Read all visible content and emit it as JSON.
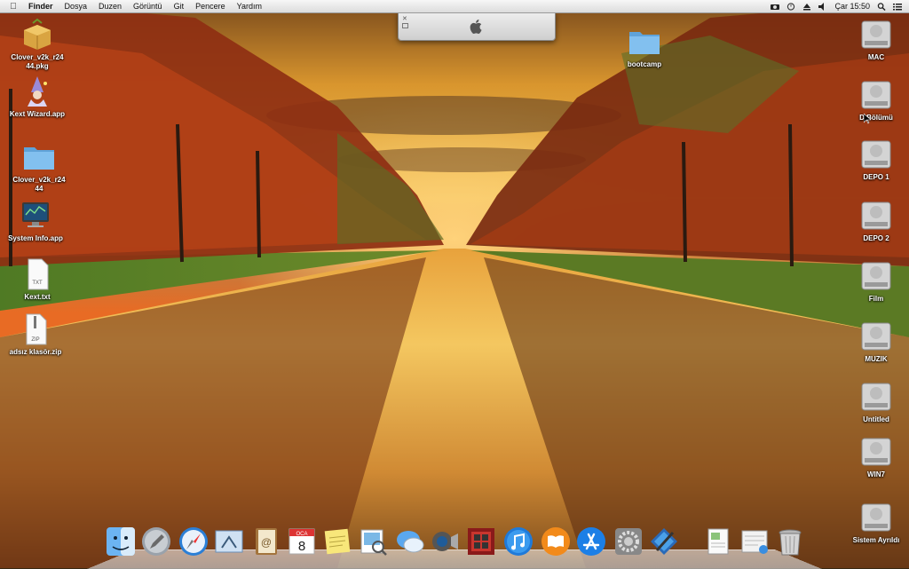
{
  "menubar": {
    "app_name": "Finder",
    "items": [
      "Dosya",
      "Duzen",
      "Görüntü",
      "Git",
      "Pencere",
      "Yardım"
    ],
    "clock": "Çar 15:50"
  },
  "desktop_icons_left": [
    {
      "label": "Clover_v2k_r24\n44.pkg",
      "icon": "package-icon"
    },
    {
      "label": "Kext Wizard.app",
      "icon": "wizard-icon"
    },
    {
      "label": "Clover_v2k_r24\n44",
      "icon": "folder-icon"
    },
    {
      "label": "System Info.app",
      "icon": "system-info-icon"
    },
    {
      "label": "Kext.txt",
      "icon": "text-file-icon"
    },
    {
      "label": "adsız klasör.zip",
      "icon": "zip-file-icon"
    }
  ],
  "desktop_icons_right": [
    {
      "label": "MAC",
      "icon": "hard-drive-icon"
    },
    {
      "label": "D Bölümü",
      "icon": "hard-drive-icon"
    },
    {
      "label": "DEPO 1",
      "icon": "hard-drive-icon"
    },
    {
      "label": "DEPO 2",
      "icon": "hard-drive-icon"
    },
    {
      "label": "Film",
      "icon": "hard-drive-icon"
    },
    {
      "label": "MUZIK",
      "icon": "hard-drive-icon"
    },
    {
      "label": "Untitled",
      "icon": "hard-drive-icon"
    },
    {
      "label": "WIN7",
      "icon": "hard-drive-icon"
    },
    {
      "label": "Sistem Ayrıldı",
      "icon": "hard-drive-icon"
    }
  ],
  "desktop_folder": {
    "label": "bootcamp",
    "icon": "folder-icon"
  },
  "dock_apps": [
    "finder-icon",
    "launchpad-icon",
    "safari-icon",
    "mail-icon",
    "address-book-icon",
    "calendar-icon",
    "stickies-icon",
    "preview-icon",
    "messages-icon",
    "facetime-icon",
    "photo-booth-icon",
    "itunes-icon",
    "ibooks-icon",
    "app-store-icon",
    "system-preferences-icon",
    "xcode-icon",
    "documents-icon",
    "downloads-icon",
    "trash-icon"
  ],
  "calendar": {
    "month": "OCA",
    "day": "8"
  },
  "colors": {
    "menubar_bg": "#e8e8e8",
    "folder_blue": "#6fb2e6",
    "label_text": "#ffffff"
  }
}
